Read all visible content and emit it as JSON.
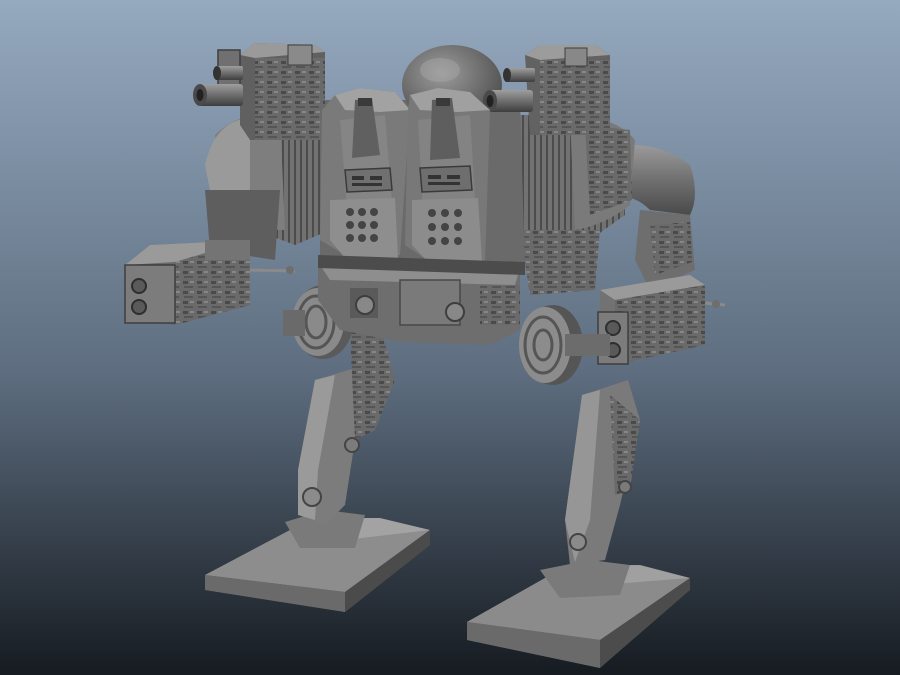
{
  "viewport": {
    "background_top": "#95a9bf",
    "background_mid": "#5e6e80",
    "background_bottom": "#161b21"
  },
  "model": {
    "base_color": "#6f6f6f",
    "light_color": "#a3a3a3",
    "mid_color": "#858585",
    "dark_color": "#474747",
    "shadow_color": "#2e2e2e",
    "detail_color": "#3a3a3a"
  }
}
